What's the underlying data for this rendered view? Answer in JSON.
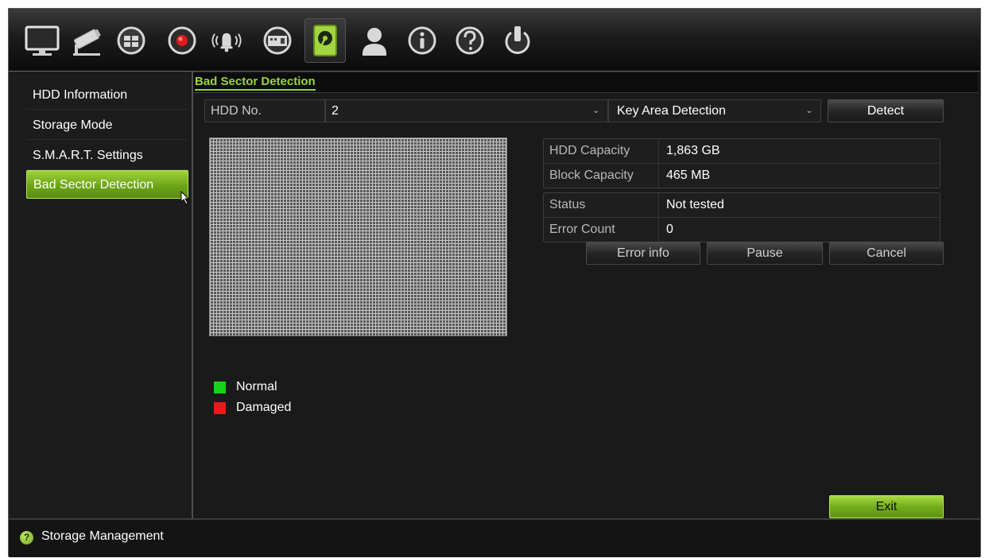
{
  "toolbar": {
    "icons": [
      "monitor-icon",
      "camera-icon",
      "network-icon",
      "record-icon",
      "alarm-icon",
      "device-icon",
      "storage-icon",
      "user-icon",
      "info-icon",
      "help-icon",
      "power-icon"
    ],
    "active_icon": "storage-icon"
  },
  "sidebar": {
    "items": [
      {
        "label": "HDD Information"
      },
      {
        "label": "Storage Mode"
      },
      {
        "label": "S.M.A.R.T. Settings"
      },
      {
        "label": "Bad Sector Detection"
      }
    ],
    "active_index": 3
  },
  "main": {
    "tab_title": "Bad Sector Detection",
    "hdd_label": "HDD No.",
    "hdd_value": "2",
    "detection_type": "Key Area Detection",
    "detect_button": "Detect",
    "capacity": {
      "hdd_capacity_label": "HDD Capacity",
      "hdd_capacity_value": "1,863 GB",
      "block_capacity_label": "Block Capacity",
      "block_capacity_value": "465 MB"
    },
    "status": {
      "status_label": "Status",
      "status_value": "Not tested",
      "error_count_label": "Error Count",
      "error_count_value": "0"
    },
    "buttons": {
      "error_info": "Error info",
      "pause": "Pause",
      "cancel": "Cancel",
      "exit": "Exit"
    },
    "legend": [
      {
        "label": "Normal",
        "color": "#19d219"
      },
      {
        "label": "Damaged",
        "color": "#e81b1b"
      }
    ]
  },
  "statusbar": {
    "title": "Storage Management"
  }
}
